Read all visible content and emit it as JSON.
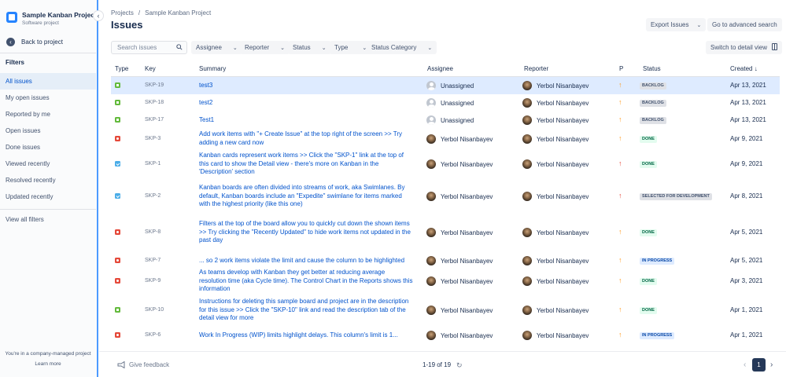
{
  "sidebar": {
    "project_name": "Sample Kanban Project",
    "project_type": "Software project",
    "back_label": "Back to project",
    "filters_heading": "Filters",
    "items": [
      {
        "label": "All issues",
        "active": true
      },
      {
        "label": "My open issues"
      },
      {
        "label": "Reported by me"
      },
      {
        "label": "Open issues"
      },
      {
        "label": "Done issues"
      },
      {
        "label": "Viewed recently"
      },
      {
        "label": "Resolved recently"
      },
      {
        "label": "Updated recently"
      }
    ],
    "view_all": "View all filters",
    "company_note": "You're in a company-managed project",
    "learn_more": "Learn more"
  },
  "header": {
    "breadcrumbs": [
      "Projects",
      "Sample Kanban Project"
    ],
    "separator": "/",
    "title": "Issues",
    "export_label": "Export Issues",
    "advanced_search_label": "Go to advanced search",
    "detail_view_label": "Switch to detail view"
  },
  "filters": {
    "search_placeholder": "Search issues",
    "assignee": "Assignee",
    "reporter": "Reporter",
    "status": "Status",
    "type": "Type",
    "status_category": "Status Category"
  },
  "table": {
    "columns": {
      "type": "Type",
      "key": "Key",
      "summary": "Summary",
      "assignee": "Assignee",
      "reporter": "Reporter",
      "priority": "P",
      "status": "Status",
      "created": "Created"
    },
    "sort_icon": "arrow-down-icon",
    "rows": [
      {
        "type": "story",
        "key": "SKP-19",
        "summary": "test3",
        "assignee": "Unassigned",
        "reporter": "Yerbol Nisanbayev",
        "priority": "medium",
        "status": "BACKLOG",
        "status_style": "backlog",
        "created": "Apr 13, 2021",
        "selected": true
      },
      {
        "type": "story",
        "key": "SKP-18",
        "summary": "test2",
        "assignee": "Unassigned",
        "reporter": "Yerbol Nisanbayev",
        "priority": "medium",
        "status": "BACKLOG",
        "status_style": "backlog",
        "created": "Apr 13, 2021"
      },
      {
        "type": "story",
        "key": "SKP-17",
        "summary": "Test1",
        "assignee": "Unassigned",
        "reporter": "Yerbol Nisanbayev",
        "priority": "medium",
        "status": "BACKLOG",
        "status_style": "backlog",
        "created": "Apr 13, 2021"
      },
      {
        "type": "bug",
        "key": "SKP-3",
        "summary": "Add work items with \"+ Create Issue\" at the top right of the screen >> Try adding a new card now",
        "assignee": "Yerbol Nisanbayev",
        "reporter": "Yerbol Nisanbayev",
        "priority": "medium",
        "status": "DONE",
        "status_style": "done",
        "created": "Apr 9, 2021"
      },
      {
        "type": "task",
        "key": "SKP-1",
        "summary": "Kanban cards represent work items >> Click the \"SKP-1\" link at the top of this card to show the Detail view - there's more on Kanban in the 'Description' section",
        "assignee": "Yerbol Nisanbayev",
        "reporter": "Yerbol Nisanbayev",
        "priority": "high",
        "status": "DONE",
        "status_style": "done",
        "created": "Apr 9, 2021"
      },
      {
        "type": "task",
        "key": "SKP-2",
        "summary": "Kanban boards are often divided into streams of work, aka Swimlanes. By default, Kanban boards include an \"Expedite\" swimlane for items marked with the highest priority (like this one)",
        "assignee": "Yerbol Nisanbayev",
        "reporter": "Yerbol Nisanbayev",
        "priority": "high",
        "status": "SELECTED FOR DEVELOPMENT",
        "status_style": "dev",
        "created": "Apr 8, 2021"
      },
      {
        "type": "bug",
        "key": "SKP-8",
        "summary": "Filters at the top of the board allow you to quickly cut down the shown items >> Try clicking the \"Recently Updated\" to hide work items not updated in the past day",
        "assignee": "Yerbol Nisanbayev",
        "reporter": "Yerbol Nisanbayev",
        "priority": "medium",
        "status": "DONE",
        "status_style": "done",
        "created": "Apr 5, 2021"
      },
      {
        "type": "bug",
        "key": "SKP-7",
        "summary": "... so 2 work items violate the limit and cause the column to be highlighted",
        "assignee": "Yerbol Nisanbayev",
        "reporter": "Yerbol Nisanbayev",
        "priority": "medium",
        "status": "IN PROGRESS",
        "status_style": "progress",
        "created": "Apr 5, 2021"
      },
      {
        "type": "bug",
        "key": "SKP-9",
        "summary": "As teams develop with Kanban they get better at reducing average resolution time (aka Cycle time). The Control Chart in the Reports shows this information",
        "assignee": "Yerbol Nisanbayev",
        "reporter": "Yerbol Nisanbayev",
        "priority": "medium",
        "status": "DONE",
        "status_style": "done",
        "created": "Apr 3, 2021"
      },
      {
        "type": "story",
        "key": "SKP-10",
        "summary": "Instructions for deleting this sample board and project are in the description for this issue >> Click the \"SKP-10\" link and read the description tab of the detail view for more",
        "assignee": "Yerbol Nisanbayev",
        "reporter": "Yerbol Nisanbayev",
        "priority": "medium",
        "status": "DONE",
        "status_style": "done",
        "created": "Apr 1, 2021"
      },
      {
        "type": "bug",
        "key": "SKP-6",
        "summary": "Work In Progress (WIP) limits highlight delays. This column's limit is 1...",
        "assignee": "Yerbol Nisanbayev",
        "reporter": "Yerbol Nisanbayev",
        "priority": "medium",
        "status": "IN PROGRESS",
        "status_style": "progress",
        "created": "Apr 1, 2021"
      }
    ]
  },
  "footer": {
    "feedback_label": "Give feedback",
    "count_label": "1-19 of 19",
    "current_page": "1"
  },
  "colors": {
    "link": "#0052CC",
    "selected_row": "#DEEBFF",
    "sidebar_active": "#E5EEF8",
    "story": "#63BA3C",
    "bug": "#E5493A",
    "task": "#4BADE8",
    "priority_medium": "#FF991F",
    "priority_high": "#E5493A"
  }
}
